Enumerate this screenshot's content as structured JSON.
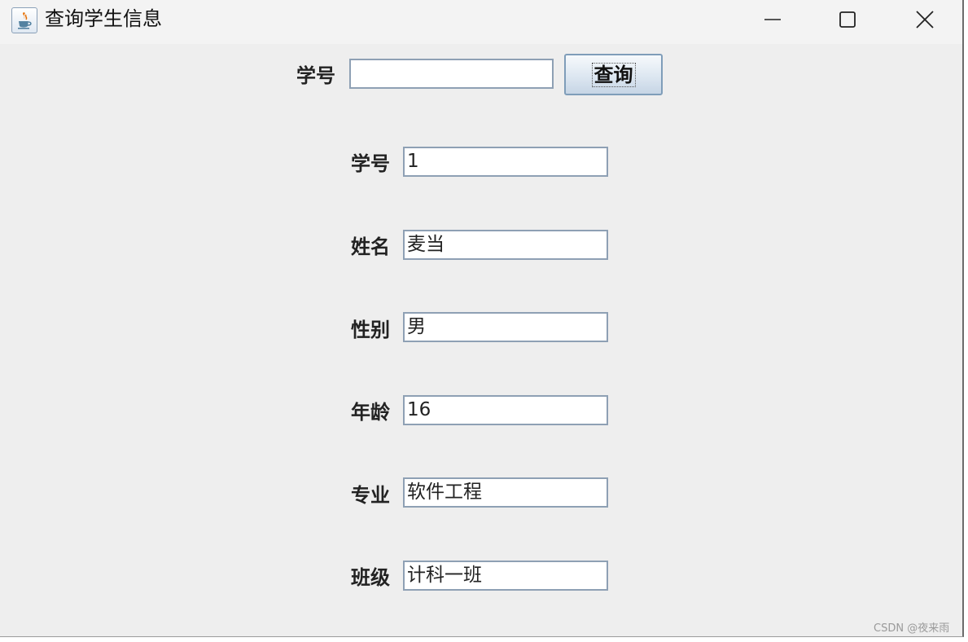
{
  "window": {
    "title": "查询学生信息",
    "icon": "java-cup-icon",
    "controls": [
      "minimize-icon",
      "maximize-icon",
      "close-icon"
    ]
  },
  "search": {
    "label": "学号",
    "value": "",
    "button_label": "查询"
  },
  "fields": [
    {
      "label": "学号",
      "value": "1"
    },
    {
      "label": "姓名",
      "value": "麦当"
    },
    {
      "label": "性别",
      "value": "男"
    },
    {
      "label": "年龄",
      "value": "16"
    },
    {
      "label": "专业",
      "value": "软件工程"
    },
    {
      "label": "班级",
      "value": "计科一班"
    }
  ],
  "watermark": "CSDN @夜来雨",
  "colors": {
    "background": "#eeeeee",
    "field_border": "#8ea0b4",
    "button_border": "#7f9db9"
  }
}
